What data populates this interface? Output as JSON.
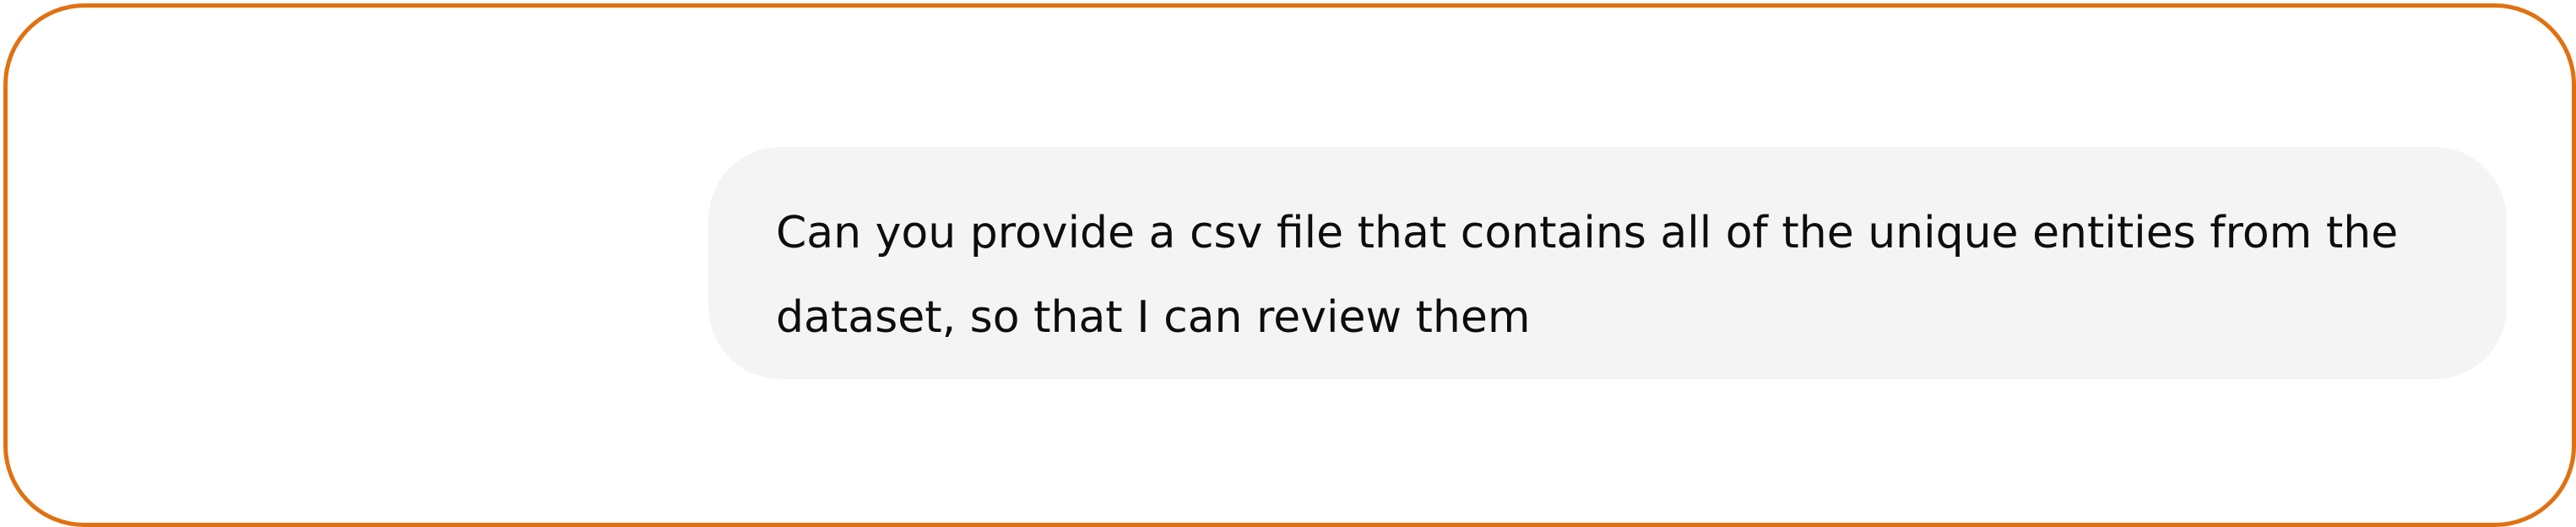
{
  "conversation": {
    "messages": [
      {
        "role": "user",
        "text": "Can you provide a csv file that contains all of the unique entities from the dataset, so that I can review them"
      }
    ]
  },
  "colors": {
    "frame_border": "#e07112",
    "bubble_background": "#f4f4f4",
    "text": "#0d0d0d"
  }
}
